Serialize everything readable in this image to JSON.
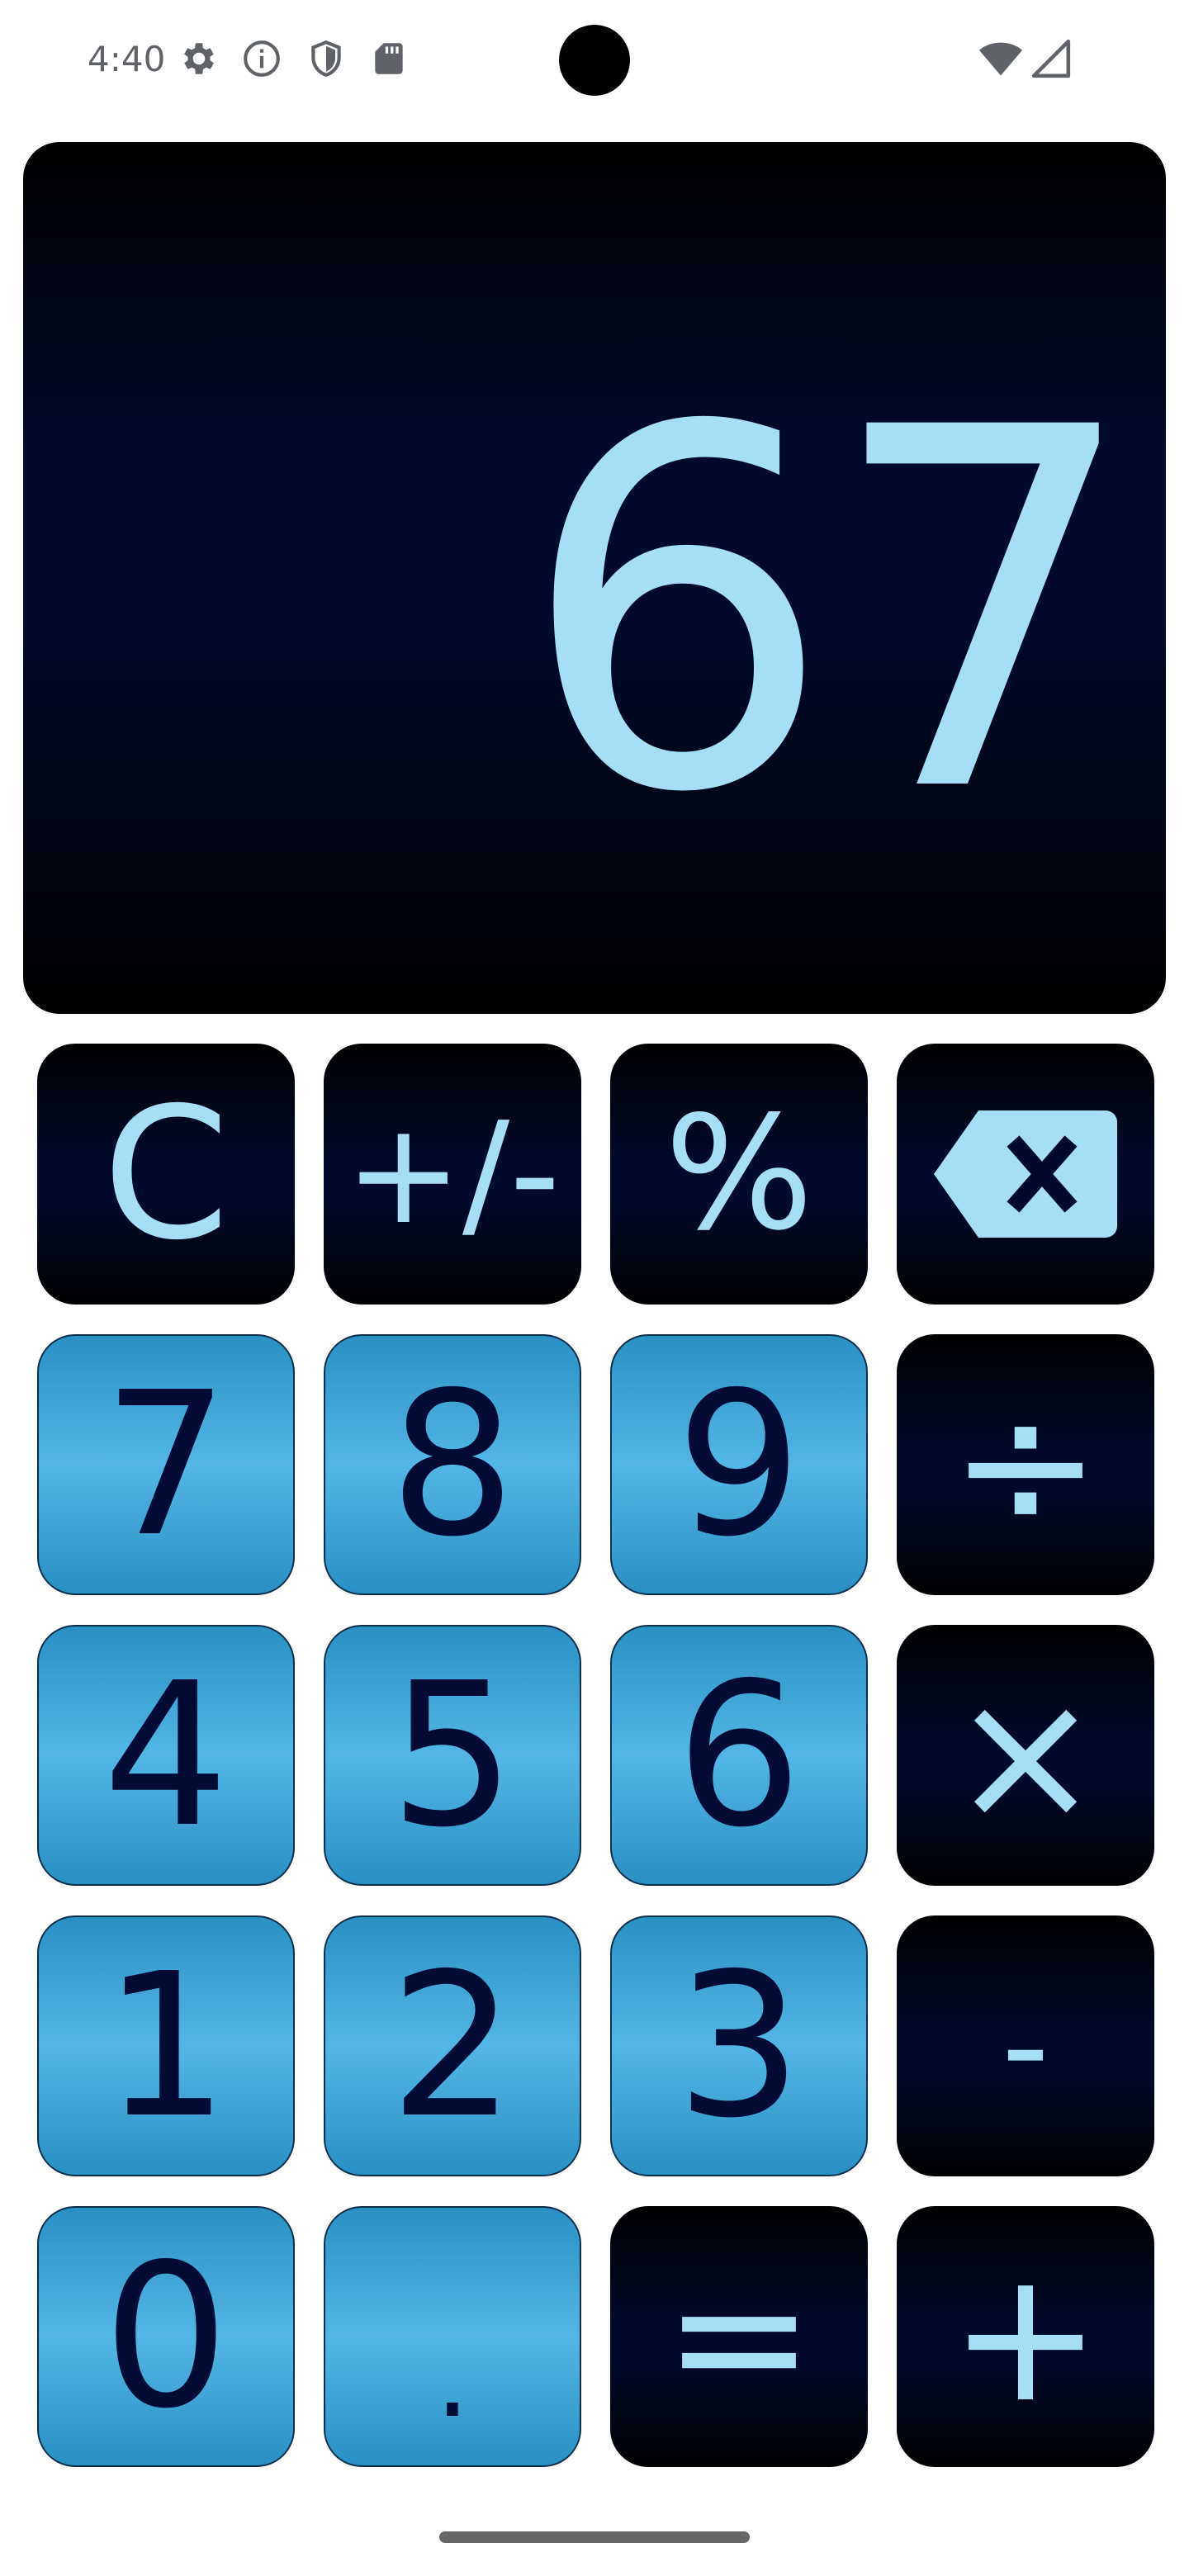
{
  "status_bar": {
    "time": "4:40",
    "icons": [
      "gear-icon",
      "info-icon",
      "shield-icon",
      "sd-card-icon",
      "wifi-icon",
      "cell-signal-icon"
    ]
  },
  "display": {
    "value": "67"
  },
  "keys": {
    "clear": "C",
    "plus_minus": "+/-",
    "percent": "%",
    "backspace": "backspace-icon",
    "seven": "7",
    "eight": "8",
    "nine": "9",
    "divide": "÷",
    "four": "4",
    "five": "5",
    "six": "6",
    "multiply": "×",
    "one": "1",
    "two": "2",
    "three": "3",
    "minus": "-",
    "zero": "0",
    "decimal": ".",
    "equals": "=",
    "plus": "+"
  },
  "colors": {
    "display_text": "#a6dff5",
    "number_key": "#4fb3e3",
    "number_text": "#020b33",
    "operator_key": "#010a2a"
  }
}
